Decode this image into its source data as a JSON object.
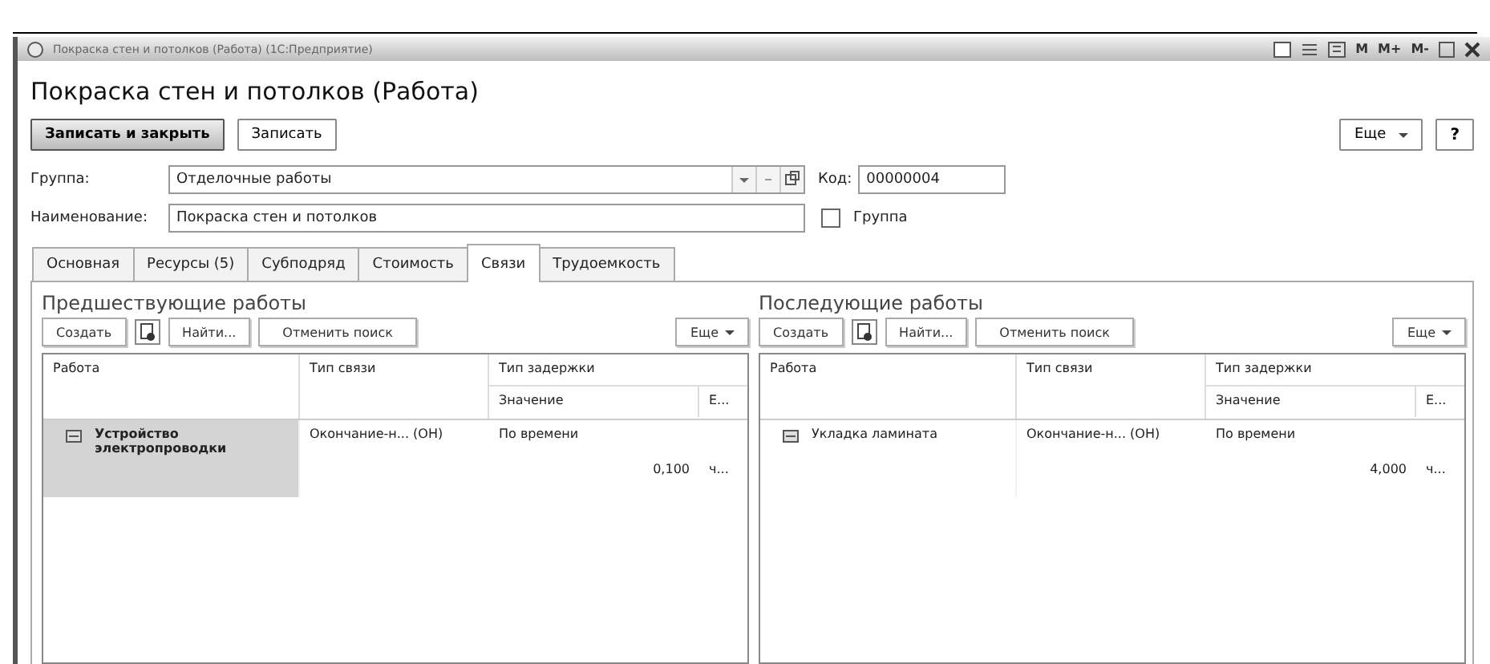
{
  "window": {
    "title": "Покраска стен и потолков (Работа) (1С:Предприятие)",
    "memory_buttons": [
      "M",
      "M+",
      "M-"
    ]
  },
  "form_title": "Покраска стен и потолков (Работа)",
  "toolbar": {
    "buttons": [
      {
        "label": "Записать и закрыть",
        "kind": "default"
      },
      {
        "label": "Записать",
        "kind": "normal"
      }
    ],
    "more": "Еще",
    "help": "?"
  },
  "fields": {
    "group": {
      "label": "Группа:",
      "value": "Отделочные работы"
    },
    "code": {
      "label": "Код:",
      "value": "00000004"
    },
    "name": {
      "label": "Наименование:",
      "value": "Покраска стен и потолков"
    },
    "is_group": {
      "label": "Группа",
      "checked": false
    }
  },
  "tabs": [
    {
      "label": "Основная",
      "selected": false
    },
    {
      "label": "Ресурсы (5)",
      "selected": false
    },
    {
      "label": "Субподряд",
      "selected": false
    },
    {
      "label": "Стоимость",
      "selected": false
    },
    {
      "label": "Связи",
      "selected": true
    },
    {
      "label": "Трудоемкость",
      "selected": false
    }
  ],
  "panels": [
    {
      "title": "Предшествующие работы",
      "buttons": [
        "Создать",
        "Найти...",
        "Отменить поиск",
        "Еще"
      ],
      "columns": [
        "Работа",
        "Тип связи",
        "Тип задержки",
        "Значение",
        "Е..."
      ],
      "rows": [
        {
          "work": "Устройство электропроводки",
          "link": "Окончание-н... (ОН)",
          "delay": "По времени",
          "value": "0,100",
          "unit": "ч...",
          "selected": true
        }
      ]
    },
    {
      "title": "Последующие работы",
      "buttons": [
        "Создать",
        "Найти...",
        "Отменить поиск",
        "Еще"
      ],
      "columns": [
        "Работа",
        "Тип связи",
        "Тип задержки",
        "Значение",
        "Е..."
      ],
      "rows": [
        {
          "work": "Укладка ламината",
          "link": "Окончание-н... (ОН)",
          "delay": "По времени",
          "value": "4,000",
          "unit": "ч...",
          "selected": false
        }
      ]
    }
  ]
}
